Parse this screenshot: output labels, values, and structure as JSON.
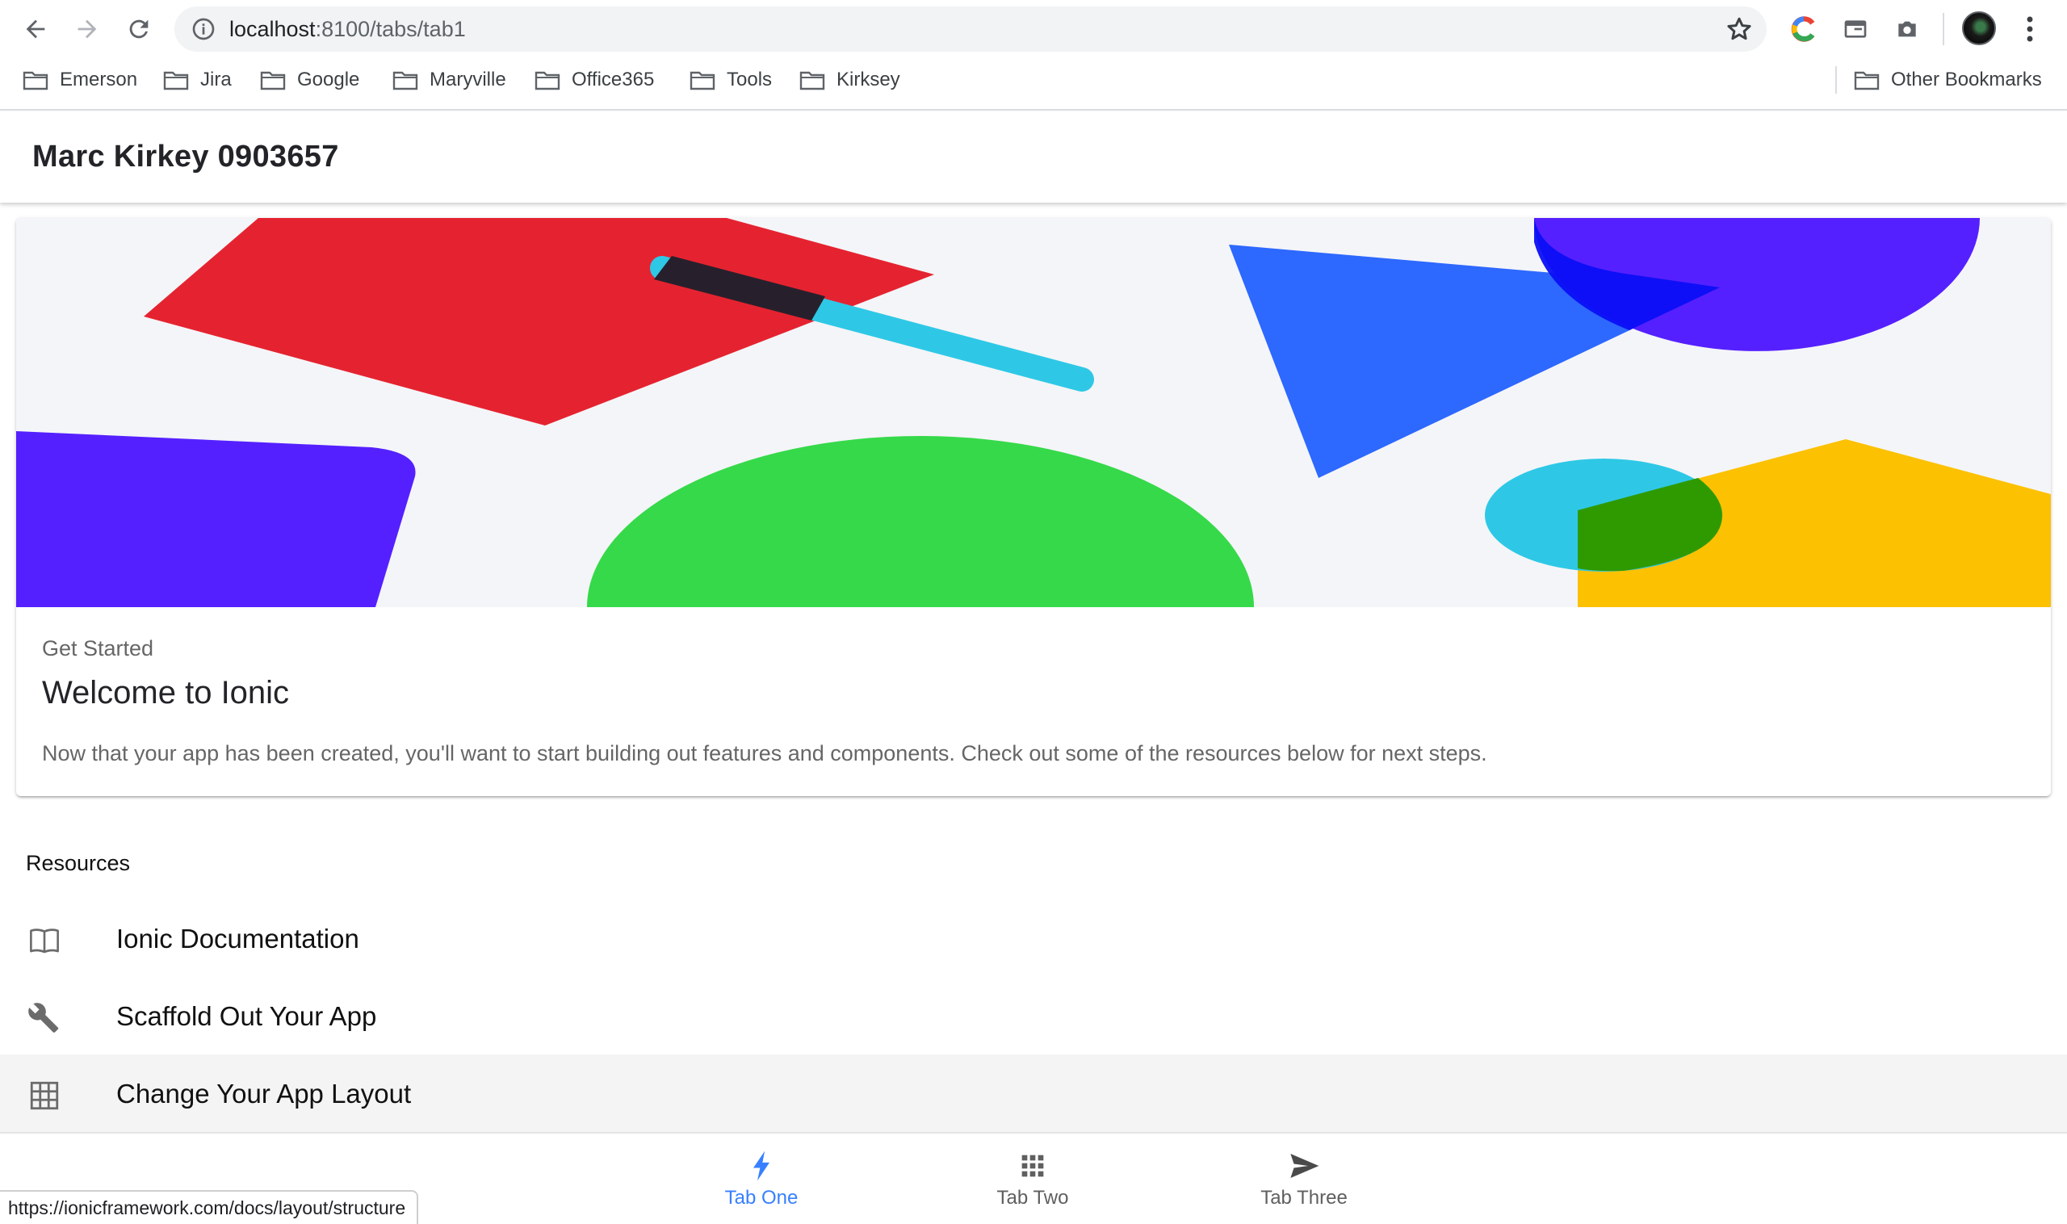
{
  "browser": {
    "url_host": "localhost",
    "url_rest": ":8100/tabs/tab1",
    "bookmarks": [
      "Emerson",
      "Jira",
      "Google",
      "Maryville",
      "Office365",
      "Tools",
      "Kirksey"
    ],
    "other_bookmarks": "Other Bookmarks",
    "status_url": "https://ionicframework.com/docs/layout/structure"
  },
  "header": {
    "title": "Marc Kirkey 0903657"
  },
  "card": {
    "subtitle": "Get Started",
    "title": "Welcome to Ionic",
    "body": "Now that your app has been created, you'll want to start building out features and components. Check out some of the resources below for next steps."
  },
  "resources": {
    "header": "Resources",
    "items": [
      {
        "label": "Ionic Documentation",
        "icon": "book-icon"
      },
      {
        "label": "Scaffold Out Your App",
        "icon": "wrench-icon"
      },
      {
        "label": "Change Your App Layout",
        "icon": "grid-icon"
      }
    ]
  },
  "tabs": [
    {
      "label": "Tab One",
      "icon": "flash-icon",
      "selected": true
    },
    {
      "label": "Tab Two",
      "icon": "apps-icon",
      "selected": false
    },
    {
      "label": "Tab Three",
      "icon": "send-icon",
      "selected": false
    }
  ],
  "colors": {
    "accent": "#3880ff",
    "header_bg": "#ffffff",
    "art_bg": "#f4f5f8",
    "shape_red": "#e52330",
    "shape_purple": "#5520ff",
    "shape_cyan": "#2ec8e6",
    "shape_blue": "#2d68ff",
    "shape_green": "#36d94a",
    "shape_yellow": "#fcc100"
  }
}
